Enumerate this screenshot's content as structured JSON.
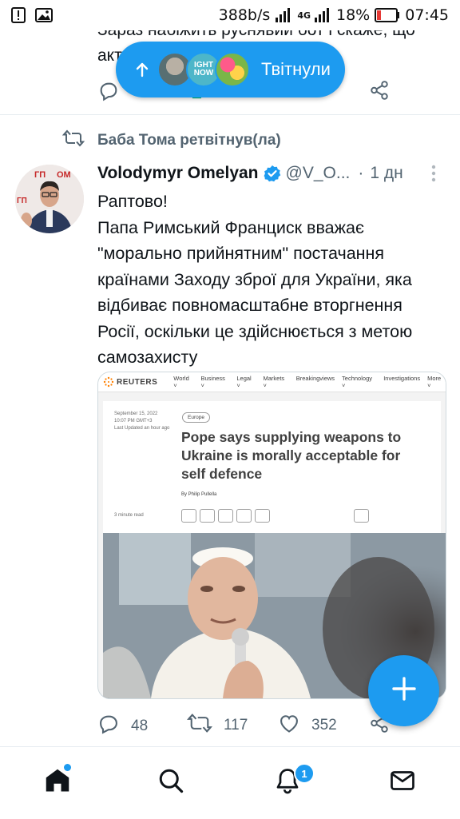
{
  "status_bar": {
    "speed": "388b/s",
    "network": "4G",
    "battery": "18%",
    "time": "07:45"
  },
  "previous_tweet": {
    "text_line1": "Зараз набіжить руснявий бот і скаже, що",
    "text_line2": "акт"
  },
  "new_tweets_pill": {
    "label": "Твітнули"
  },
  "retweet": {
    "label": "Баба Тома ретвітнув(ла)"
  },
  "tweet": {
    "author_name": "Volodymyr Omelyan",
    "handle": "@V_O...",
    "separator": "·",
    "time": "1 дн",
    "text_lines": [
      "Раптово!",
      "Папа Римський Франциск вважає \"морально прийнятним\" постачання країнами Заходу зброї для України, яка відбиває повномасштабне вторгнення Росії, оскільки це здійснюється з метою самозахисту"
    ],
    "media": {
      "site_logo": "REUTERS",
      "nav_items": [
        "World ˅",
        "Business ˅",
        "Legal ˅",
        "Markets ˅",
        "Breakingviews",
        "Technology ˅",
        "Investigations",
        "More ˅"
      ],
      "date_line1": "September 15, 2022",
      "date_line2": "10:07 PM GMT+3",
      "date_line3": "Last Updated an hour ago",
      "section_tag": "Europe",
      "headline": "Pope says supplying weapons to Ukraine is morally acceptable for self defence",
      "byline": "By Philip Pullella",
      "read_time": "3 minute read"
    },
    "stats": {
      "replies": "48",
      "retweets": "117",
      "likes": "352"
    }
  },
  "bottom_nav": {
    "notifications_badge": "1"
  },
  "colors": {
    "accent": "#1d9bf0",
    "secondary_text": "#536471",
    "primary_text": "#0f1419"
  }
}
